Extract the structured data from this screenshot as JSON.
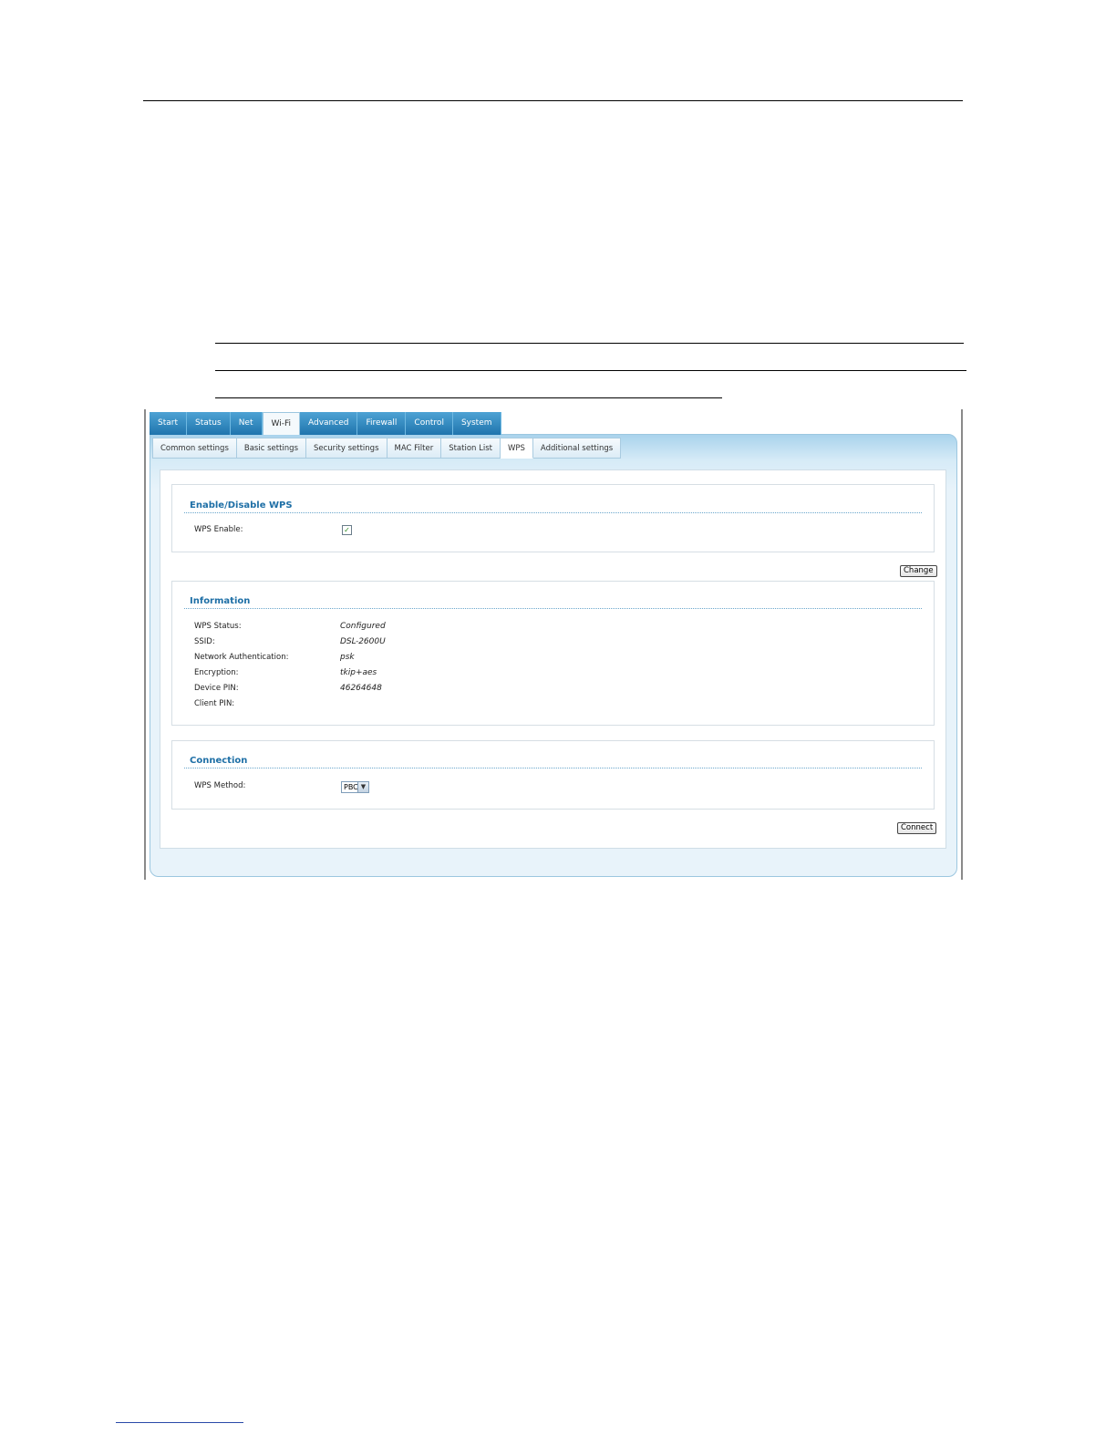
{
  "top_tabs": [
    "Start",
    "Status",
    "Net",
    "Wi-Fi",
    "Advanced",
    "Firewall",
    "Control",
    "System"
  ],
  "active_top_tab": "Wi-Fi",
  "sub_tabs": [
    "Common settings",
    "Basic settings",
    "Security settings",
    "MAC Filter",
    "Station List",
    "WPS",
    "Additional settings"
  ],
  "active_sub_tab": "WPS",
  "enable_section": {
    "title": "Enable/Disable WPS",
    "wps_enable_label": "WPS Enable:",
    "wps_enable_checked": true
  },
  "change_button": "Change",
  "information": {
    "title": "Information",
    "rows": [
      {
        "label": "WPS Status:",
        "value": "Configured"
      },
      {
        "label": "SSID:",
        "value": "DSL-2600U"
      },
      {
        "label": "Network Authentication:",
        "value": "psk"
      },
      {
        "label": "Encryption:",
        "value": "tkip+aes"
      },
      {
        "label": "Device PIN:",
        "value": "46264648"
      },
      {
        "label": "Client PIN:",
        "value": ""
      }
    ]
  },
  "connection": {
    "title": "Connection",
    "wps_method_label": "WPS Method:",
    "wps_method_value": "PBC"
  },
  "connect_button": "Connect",
  "colors": {
    "tab_blue": "#1f74ad",
    "section_title": "#1e6fa6",
    "panel_bg": "#e8f3fa"
  }
}
